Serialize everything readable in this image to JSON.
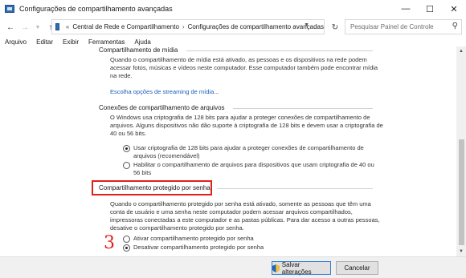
{
  "window": {
    "title": "Configurações de compartilhamento avançadas"
  },
  "address_bar": {
    "back_icon": "arrow-left-icon",
    "forward_icon": "arrow-right-icon",
    "up_icon": "arrow-up-icon",
    "breadcrumbs": [
      "Central de Rede e Compartilhamento",
      "Configurações de compartilhamento avançadas"
    ],
    "search_placeholder": "Pesquisar Painel de Controle"
  },
  "menu": {
    "items": [
      "Arquivo",
      "Editar",
      "Exibir",
      "Ferramentas",
      "Ajuda"
    ]
  },
  "sections": {
    "media": {
      "title": "Compartilhamento de mídia",
      "description": "Quando o compartilhamento de mídia está ativado, as pessoas e os dispositivos na rede podem acessar fotos, músicas e vídeos neste computador. Esse computador também pode encontrar mídia na rede.",
      "link": "Escolha opções de streaming de mídia..."
    },
    "file_sharing": {
      "title": "Conexões de compartilhamento de arquivos",
      "description": "O Windows usa criptografia de 128 bits para ajudar a proteger conexões de compartilhamento de arquivos. Alguns dispositivos não dão suporte à criptografia de 128 bits e devem usar a criptografia de 40 ou 56 bits.",
      "options": [
        {
          "label": "Usar criptografia de 128 bits para ajudar a proteger conexões de compartilhamento de arquivos (recomendável)",
          "checked": true
        },
        {
          "label": "Habilitar o compartilhamento de arquivos para dispositivos que usam criptografia de 40 ou 56 bits",
          "checked": false
        }
      ]
    },
    "password": {
      "title": "Compartilhamento protegido por senha",
      "description": "Quando o compartilhamento protegido por senha está ativado, somente as pessoas que têm uma conta de usuário e uma senha neste computador podem acessar arquivos compartilhados, impressoras conectadas a este computador e as pastas públicas. Para dar acesso a outras pessoas, desative o compartilhamento protegido por senha.",
      "options": [
        {
          "label": "Ativar compartilhamento protegido por senha",
          "checked": false
        },
        {
          "label": "Desativar compartilhamento protegido por senha",
          "checked": true
        }
      ]
    }
  },
  "annotation": {
    "step_number": "3",
    "color": "#e0201b"
  },
  "footer": {
    "save_label": "Salvar alterações",
    "cancel_label": "Cancelar"
  }
}
